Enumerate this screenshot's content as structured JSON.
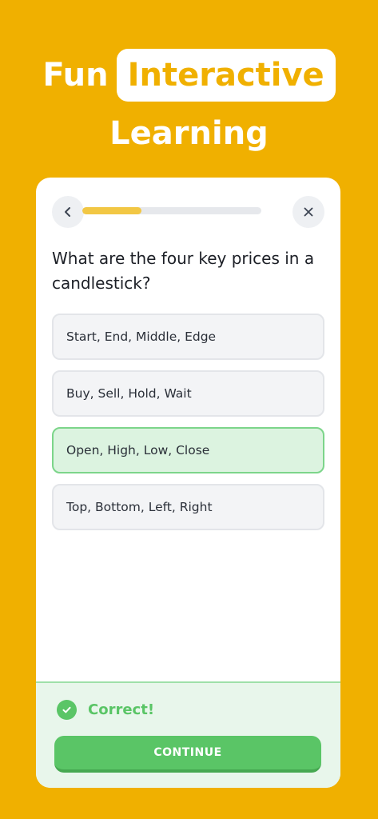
{
  "headline": {
    "word1": "Fun",
    "highlight": "Interactive",
    "line2": "Learning"
  },
  "quiz": {
    "back_icon": "chevron-left-icon",
    "close_icon": "close-icon",
    "progress_fraction": 0.33,
    "question": "What are the four key prices in a candlestick?",
    "options": [
      {
        "label": "Start, End, Middle, Edge",
        "state": "default"
      },
      {
        "label": "Buy, Sell, Hold, Wait",
        "state": "default"
      },
      {
        "label": "Open, High, Low, Close",
        "state": "correct"
      },
      {
        "label": "Top, Bottom, Left, Right",
        "state": "default"
      }
    ],
    "feedback": "Correct!",
    "continue_label": "CONTINUE"
  },
  "colors": {
    "background": "#F0B000",
    "accent_green": "#5AC566",
    "progress_yellow": "#F2C744"
  }
}
